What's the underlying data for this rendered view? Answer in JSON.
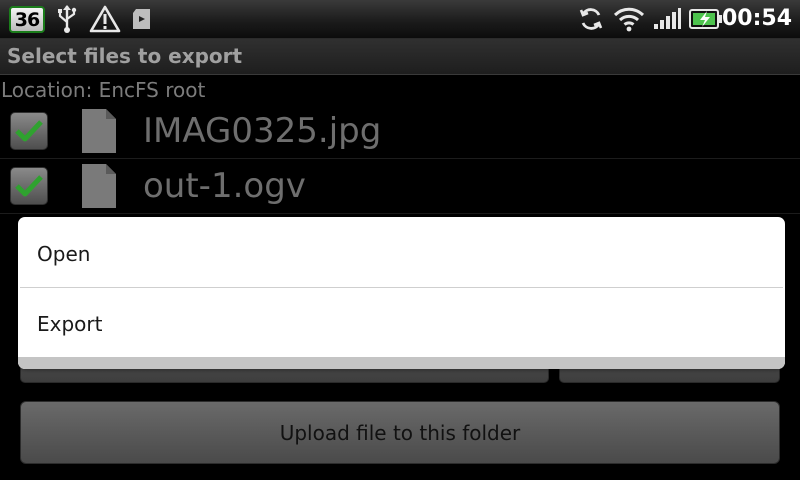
{
  "statusbar": {
    "notification_count": "36",
    "icons": [
      "usb-icon",
      "warning-icon",
      "sd-card-icon",
      "sync-icon",
      "wifi-icon",
      "signal-icon",
      "battery-charging-icon"
    ],
    "time": "00:54"
  },
  "header": {
    "title": "Select files to export"
  },
  "browser": {
    "location_label": "Location: EncFS root",
    "files": [
      {
        "name": "IMAG0325.jpg",
        "checked": true
      },
      {
        "name": "out-1.ogv",
        "checked": true
      }
    ],
    "upload_button_label": "Upload file to this folder"
  },
  "context_menu": {
    "items": [
      {
        "label": "Open"
      },
      {
        "label": "Export"
      }
    ]
  },
  "colors": {
    "check_green": "#2fa22f",
    "dialog_bg": "#ffffff",
    "screen_bg": "#000000"
  }
}
